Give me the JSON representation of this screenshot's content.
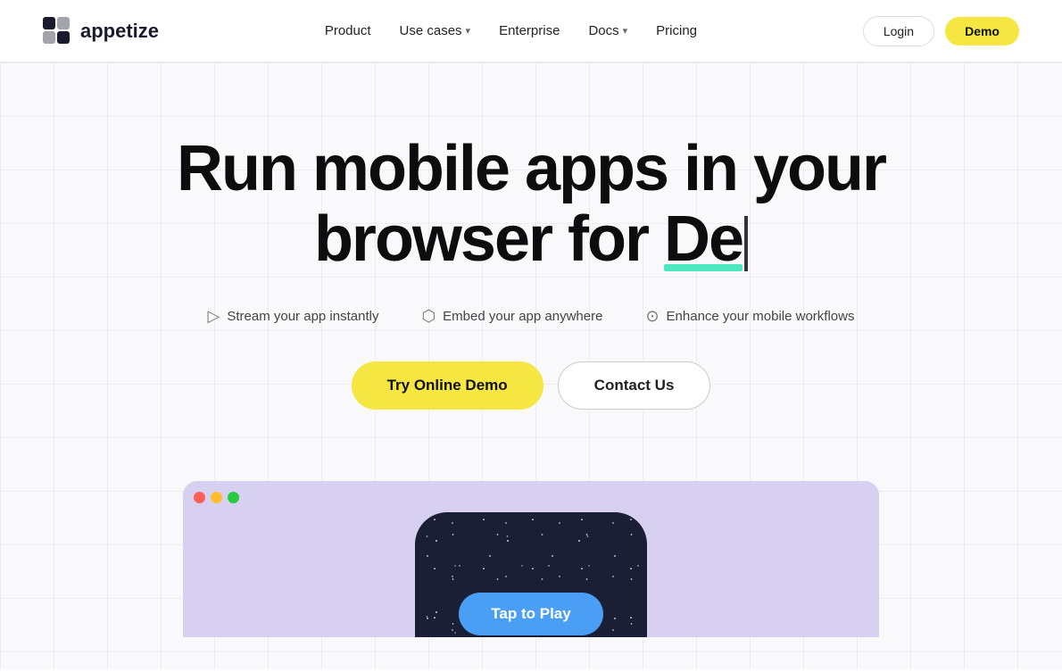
{
  "nav": {
    "logo_text": "appetize",
    "links": [
      {
        "label": "Product",
        "has_chevron": false
      },
      {
        "label": "Use cases",
        "has_chevron": true
      },
      {
        "label": "Enterprise",
        "has_chevron": false
      },
      {
        "label": "Docs",
        "has_chevron": true
      },
      {
        "label": "Pricing",
        "has_chevron": false
      }
    ],
    "login_label": "Login",
    "demo_label": "Demo"
  },
  "hero": {
    "title_line1": "Run mobile apps in your",
    "title_line2_prefix": "browser for ",
    "title_line2_highlight": "De",
    "features": [
      {
        "icon": "▷",
        "label": "Stream your app instantly"
      },
      {
        "icon": "⬡",
        "label": "Embed your app anywhere"
      },
      {
        "icon": "⊙",
        "label": "Enhance your mobile workflows"
      }
    ],
    "btn_try": "Try Online Demo",
    "btn_contact": "Contact Us"
  },
  "phone": {
    "tap_label": "Tap to Play"
  },
  "browser": {
    "dots": [
      "red",
      "yellow",
      "green"
    ]
  }
}
